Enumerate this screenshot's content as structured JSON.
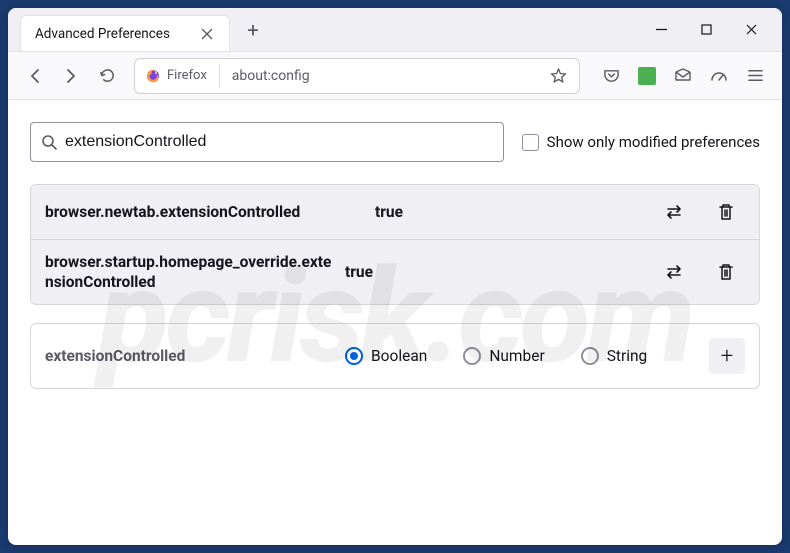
{
  "window": {
    "tab_title": "Advanced Preferences"
  },
  "toolbar": {
    "identity_label": "Firefox",
    "url": "about:config"
  },
  "config": {
    "search_value": "extensionControlled",
    "show_modified_label": "Show only modified preferences",
    "prefs": [
      {
        "name": "browser.newtab.extensionControlled",
        "value": "true"
      },
      {
        "name": "browser.startup.homepage_override.extensionControlled",
        "value": "true"
      }
    ],
    "new_pref": {
      "name": "extensionControlled",
      "type_options": [
        "Boolean",
        "Number",
        "String"
      ],
      "selected": "Boolean"
    }
  },
  "watermark": "pcrisk.com"
}
